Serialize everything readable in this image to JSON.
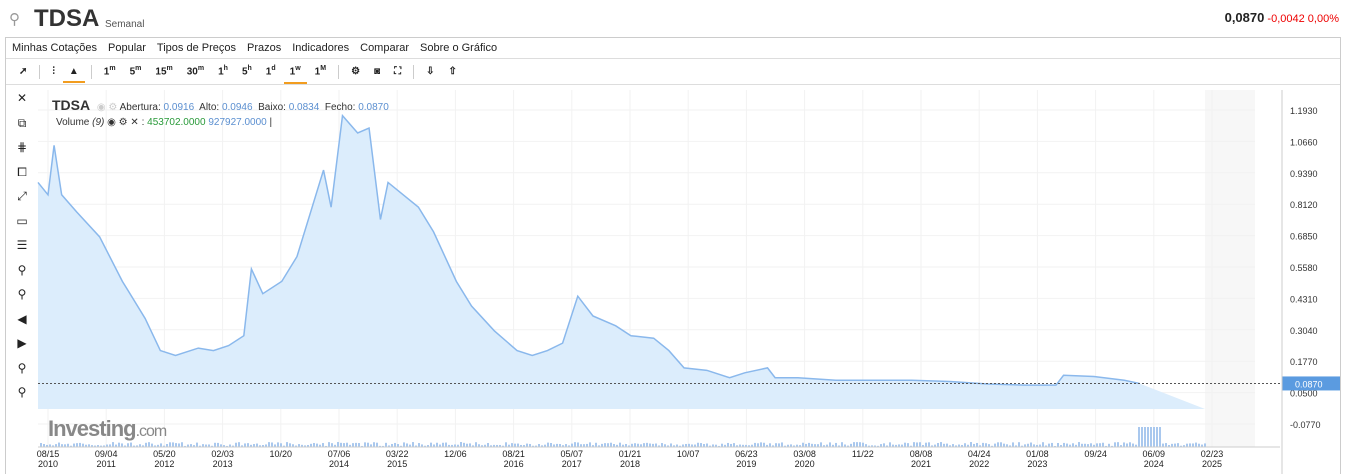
{
  "header": {
    "symbol": "TDSA",
    "period": "Semanal",
    "price": "0,0870",
    "change": "-0,0042",
    "change_pct": "0,00%"
  },
  "menu": [
    "Minhas Cotações",
    "Popular",
    "Tipos de Preços",
    "Prazos",
    "Indicadores",
    "Comparar",
    "Sobre o Gráfico"
  ],
  "timeframes": [
    {
      "n": "1",
      "s": "m"
    },
    {
      "n": "5",
      "s": "m"
    },
    {
      "n": "15",
      "s": "m"
    },
    {
      "n": "30",
      "s": "m"
    },
    {
      "n": "1",
      "s": "h"
    },
    {
      "n": "5",
      "s": "h"
    },
    {
      "n": "1",
      "s": "d"
    },
    {
      "n": "1",
      "s": "w",
      "active": true
    },
    {
      "n": "1",
      "s": "M"
    }
  ],
  "legend": {
    "symbol": "TDSA",
    "open_label": "Abertura:",
    "open": "0.0916",
    "high_label": "Alto:",
    "high": "0.0946",
    "low_label": "Baixo:",
    "low": "0.0834",
    "close_label": "Fecho:",
    "close": "0.0870",
    "volume_label": "Volume",
    "volume_period": "(9)",
    "volume_1": "453702.0000",
    "volume_2": "927927.0000"
  },
  "logo": {
    "text": "Investing",
    "suffix": ".com"
  },
  "chart_data": {
    "type": "area",
    "series": [
      {
        "name": "TDSA",
        "color": "#8ab8ec",
        "x": [
          2010.55,
          2010.62,
          2010.7,
          2010.8,
          2011.0,
          2011.3,
          2011.6,
          2011.9,
          2012.1,
          2012.3,
          2012.6,
          2012.8,
          2013.0,
          2013.2,
          2013.3,
          2013.45,
          2013.7,
          2013.9,
          2014.1,
          2014.25,
          2014.35,
          2014.5,
          2014.7,
          2014.85,
          2015.0,
          2015.1,
          2015.3,
          2015.5,
          2015.7,
          2016.0,
          2016.2,
          2016.5,
          2016.8,
          2017.0,
          2017.2,
          2017.4,
          2017.6,
          2017.8,
          2018.1,
          2018.3,
          2018.6,
          2018.8,
          2019.0,
          2019.3,
          2019.6,
          2019.8,
          2020.1,
          2020.2,
          2020.5,
          2021.0,
          2022.0,
          2022.5,
          2023.0,
          2023.5,
          2023.9,
          2024.0,
          2024.4,
          2024.8,
          2025.0
        ],
        "y": [
          0.9,
          0.85,
          1.05,
          0.85,
          0.78,
          0.68,
          0.5,
          0.35,
          0.22,
          0.2,
          0.23,
          0.22,
          0.24,
          0.28,
          0.55,
          0.45,
          0.5,
          0.6,
          0.8,
          0.95,
          0.8,
          1.17,
          1.1,
          1.12,
          0.75,
          0.9,
          0.85,
          0.8,
          0.7,
          0.5,
          0.4,
          0.3,
          0.22,
          0.2,
          0.22,
          0.25,
          0.44,
          0.36,
          0.32,
          0.28,
          0.27,
          0.22,
          0.15,
          0.14,
          0.11,
          0.13,
          0.15,
          0.11,
          0.11,
          0.1,
          0.1,
          0.095,
          0.085,
          0.08,
          0.08,
          0.12,
          0.115,
          0.1,
          0.087
        ]
      }
    ],
    "last_value": "0.0870",
    "y_ticks": [
      "1.1930",
      "1.0660",
      "0.9390",
      "0.8120",
      "0.6850",
      "0.5580",
      "0.4310",
      "0.3040",
      "0.1770",
      "0.0500",
      "-0.0770"
    ],
    "ylim": [
      -0.077,
      1.193
    ],
    "x_ticks": [
      [
        "08/15",
        "2010"
      ],
      [
        "09/04",
        "2011"
      ],
      [
        "05/20",
        "2012"
      ],
      [
        "02/03",
        "2013"
      ],
      [
        "10/20",
        ""
      ],
      [
        "07/06",
        "2014"
      ],
      [
        "03/22",
        "2015"
      ],
      [
        "12/06",
        ""
      ],
      [
        "08/21",
        "2016"
      ],
      [
        "05/07",
        "2017"
      ],
      [
        "01/21",
        "2018"
      ],
      [
        "10/07",
        ""
      ],
      [
        "06/23",
        "2019"
      ],
      [
        "03/08",
        "2020"
      ],
      [
        "11/22",
        ""
      ],
      [
        "08/08",
        "2021"
      ],
      [
        "04/24",
        "2022"
      ],
      [
        "01/08",
        "2023"
      ],
      [
        "09/24",
        ""
      ],
      [
        "06/09",
        "2024"
      ],
      [
        "02/23",
        "2025"
      ]
    ]
  }
}
